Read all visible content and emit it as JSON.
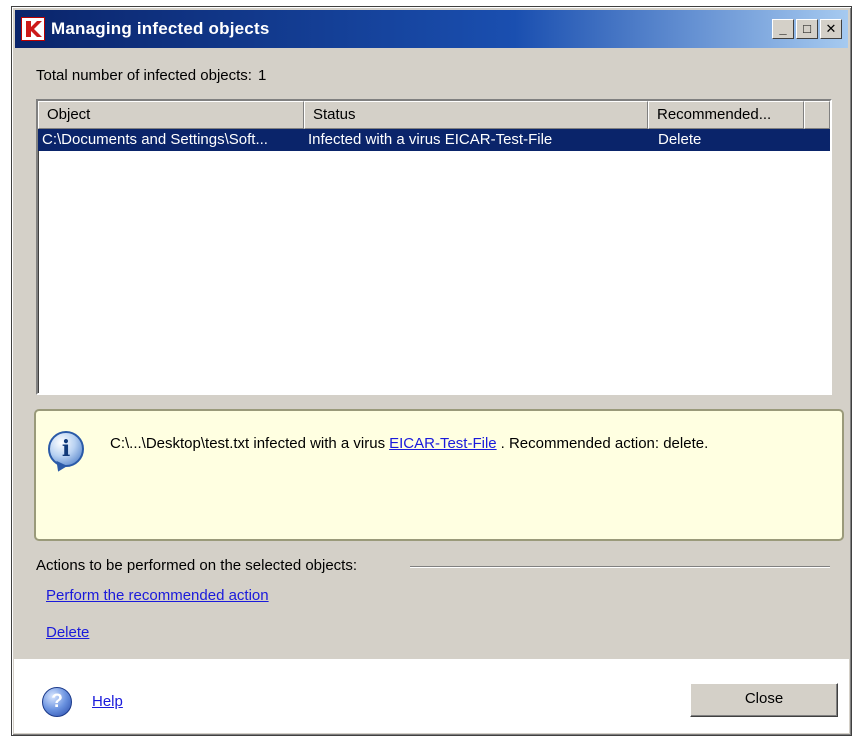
{
  "window": {
    "title": "Managing infected objects",
    "icon": "kaspersky-k-icon",
    "controls": {
      "minimize": "_",
      "maximize": "□",
      "close": "✕"
    }
  },
  "summary": {
    "label": "Total number of infected objects:",
    "count": "1"
  },
  "table": {
    "columns": [
      "Object",
      "Status",
      "Recommended..."
    ],
    "rows": [
      {
        "object": "C:\\Documents and Settings\\Soft...",
        "status": "Infected with a virus EICAR-Test-File",
        "recommended": "Delete",
        "selected": true
      }
    ]
  },
  "info": {
    "icon": "info-icon",
    "prefix": "C:\\...\\Desktop\\test.txt infected with a virus",
    "virus_link": "EICAR-Test-File",
    "suffix": ". Recommended action: delete."
  },
  "actions": {
    "label": "Actions to be performed on the selected objects:",
    "perform_recommended": "Perform the recommended action",
    "delete": "Delete"
  },
  "footer": {
    "help_icon": "help-icon",
    "help_label": "Help",
    "close_label": "Close"
  },
  "colors": {
    "titlebar": "#0a246a",
    "selection": "#0a246a",
    "info_background": "#ffffe1",
    "link": "#1a1adb",
    "dialog_face": "#d4d0c8"
  }
}
